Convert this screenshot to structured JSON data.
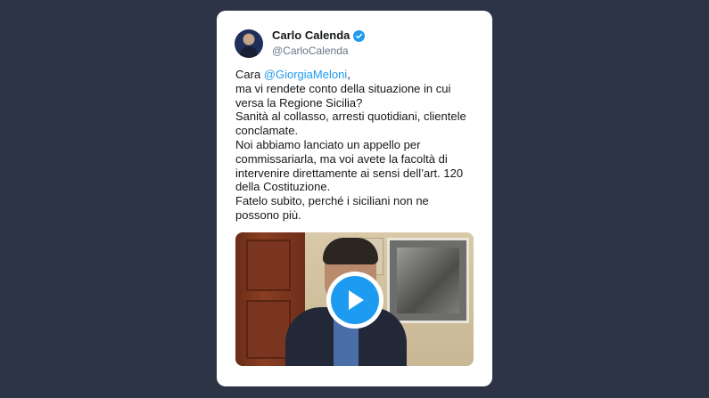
{
  "tweet": {
    "author": {
      "display_name": "Carlo Calenda",
      "handle": "@CarloCalenda",
      "verified": true
    },
    "text_lines": [
      {
        "prefix": "Cara ",
        "mention": "@GiorgiaMeloni",
        "suffix": ","
      },
      {
        "text": "ma vi rendete conto della situazione in cui"
      },
      {
        "text": "versa la Regione Sicilia?"
      },
      {
        "text": "Sanità al collasso, arresti quotidiani, clientele"
      },
      {
        "text": "conclamate."
      },
      {
        "text": "Noi abbiamo lanciato un appello per"
      },
      {
        "text": "commissariarla, ma voi avete la facoltà di"
      },
      {
        "text": "intervenire direttamente ai sensi dell’art. 120"
      },
      {
        "text": "della Costituzione."
      },
      {
        "text": "Fatelo subito, perché i siciliani non ne"
      },
      {
        "text": "possono più."
      }
    ],
    "media": {
      "type": "video",
      "play_icon": "play-icon"
    }
  },
  "colors": {
    "background": "#2d3446",
    "card": "#ffffff",
    "accent": "#1d9bf0",
    "text": "#14171a",
    "secondary_text": "#657786"
  }
}
